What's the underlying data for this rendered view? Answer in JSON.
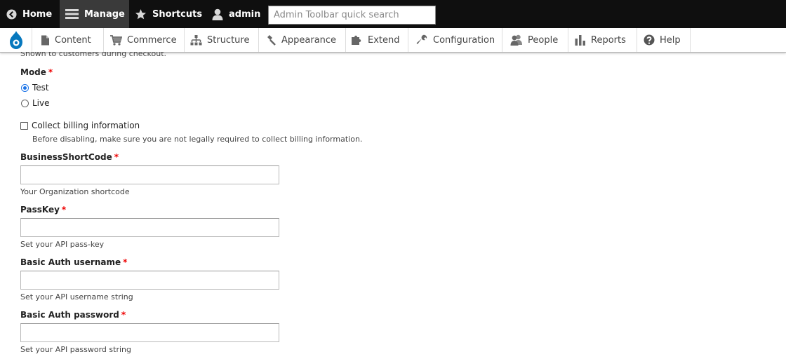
{
  "toolbar": {
    "home": "Home",
    "manage": "Manage",
    "shortcuts": "Shortcuts",
    "user": "admin",
    "search_placeholder": "Admin Toolbar quick search"
  },
  "menu": {
    "items": [
      "Content",
      "Commerce",
      "Structure",
      "Appearance",
      "Extend",
      "Configuration",
      "People",
      "Reports",
      "Help"
    ]
  },
  "form": {
    "top_description": "Shown to customers during checkout.",
    "mode": {
      "label": "Mode",
      "required": "*",
      "options": [
        "Test",
        "Live"
      ],
      "selected": "Test"
    },
    "billing": {
      "label": "Collect billing information",
      "checked": false,
      "description": "Before disabling, make sure you are not legally required to collect billing information."
    },
    "fields": [
      {
        "label": "BusinessShortCode",
        "required": "*",
        "value": "",
        "description": "Your Organization shortcode"
      },
      {
        "label": "PassKey",
        "required": "*",
        "value": "",
        "description": "Set your API pass-key"
      },
      {
        "label": "Basic Auth username",
        "required": "*",
        "value": "",
        "description": "Set your API username string"
      },
      {
        "label": "Basic Auth password",
        "required": "*",
        "value": "",
        "description": "Set your API password string"
      }
    ]
  },
  "colors": {
    "toolbar_bg": "#0f0f0f",
    "active_bg": "#3a3a3a",
    "required": "#e00000",
    "drupal_blue": "#0678be",
    "radio_accent": "#1a73e8"
  }
}
